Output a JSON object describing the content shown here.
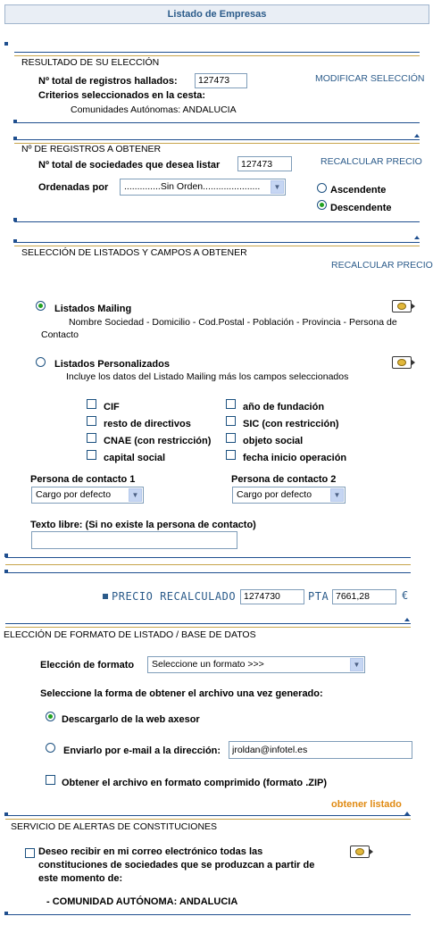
{
  "page_title": "Listado de Empresas",
  "resultado": {
    "section_title": "RESULTADO DE SU ELECCIÓN",
    "total_label": "Nº total de registros hallados:",
    "total_value": "127473",
    "criterios_label": "Criterios seleccionados en la cesta:",
    "criterios_value": "Comunidades Autónomas: ANDALUCIA",
    "modificar_link": "MODIFICAR SELECCIÓN"
  },
  "registros": {
    "section_title": "Nº DE REGISTROS A OBTENER",
    "total_label": "Nº total de sociedades que desea listar",
    "total_value": "127473",
    "recalcular_link": "RECALCULAR PRECIO",
    "ordenadas_label": "Ordenadas por",
    "ordenadas_value": "..............Sin Orden......................",
    "ascendente": "Ascendente",
    "descendente": "Descendente"
  },
  "listados": {
    "section_title": "SELECCIÓN DE LISTADOS Y CAMPOS A OBTENER",
    "recalcular_link": "RECALCULAR PRECIO",
    "mailing_label": "Listados Mailing",
    "mailing_desc_1": "Nombre Sociedad - Domicilio - Cod.Postal - Población - Provincia - Persona de",
    "mailing_desc_2": "Contacto",
    "personalizados_label": "Listados Personalizados",
    "personalizados_desc": "Incluye los datos del Listado Mailing más los campos seleccionados",
    "fields_left": [
      "CIF",
      "resto de directivos",
      "CNAE (con restricción)",
      "capital social"
    ],
    "fields_right": [
      "año de fundación",
      "SIC (con restricción)",
      "objeto social",
      "fecha inicio operación"
    ],
    "contacto1_label": "Persona de contacto 1",
    "contacto1_value": "Cargo por defecto",
    "contacto2_label": "Persona de contacto 2",
    "contacto2_value": "Cargo por defecto",
    "texto_libre_label": "Texto libre: (Si no existe la persona de contacto)"
  },
  "precio": {
    "label": "PRECIO RECALCULADO",
    "pta_value": "1274730",
    "pta_label": "PTA",
    "euro_value": "7661,28",
    "euro_symbol": "€"
  },
  "formato": {
    "section_title": "ELECCIÓN DE FORMATO DE LISTADO / BASE DE DATOS",
    "formato_label": "Elección de formato",
    "formato_value": "Seleccione un formato >>>",
    "obtener_label": "Seleccione la forma de obtener el archivo una vez generado:",
    "descargar_label": "Descargarlo de la web axesor",
    "email_label": "Enviarlo por e-mail a la dirección:",
    "email_value": "jroldan@infotel.es",
    "zip_label": "Obtener el archivo en formato comprimido (formato .ZIP)",
    "obtener_link": "obtener listado"
  },
  "alertas": {
    "section_title": "SERVICIO DE ALERTAS DE CONSTITUCIONES",
    "desc_1": "Deseo recibir en mi correo electrónico todas las",
    "desc_2": "constituciones de sociedades que se produzcan a partir de",
    "desc_3": "este momento de:",
    "region": "- COMUNIDAD AUTÓNOMA: ANDALUCIA"
  },
  "colors": {
    "accent_blue": "#1f4f8f",
    "link_blue": "#2b5b8a",
    "gold_line": "#c7a44a",
    "orange": "#e08a12",
    "radio_green": "#21a121"
  }
}
